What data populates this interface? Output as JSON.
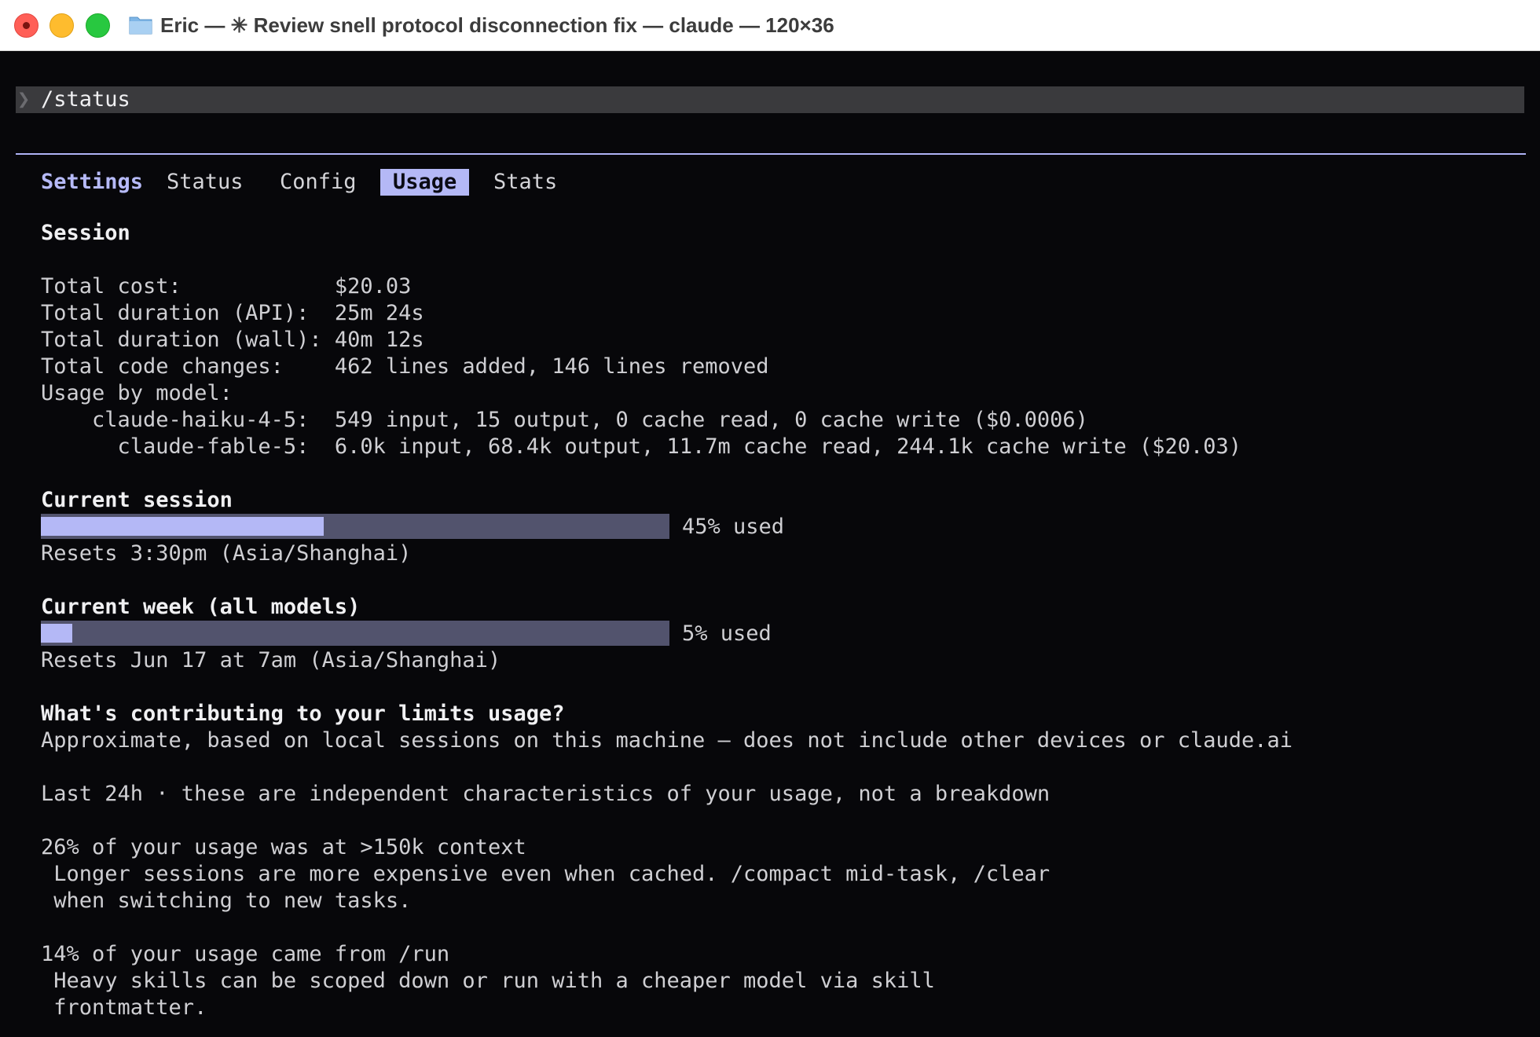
{
  "window": {
    "title": "Eric — ✳ Review snell protocol disconnection fix — claude — 120×36",
    "icon": "folder-icon"
  },
  "prompt": {
    "chevron": "❯",
    "command": "/status"
  },
  "tabs": {
    "title": "Settings",
    "items": [
      "Status",
      "Config",
      "Usage",
      "Stats"
    ],
    "active": "Usage"
  },
  "session": {
    "heading": "Session",
    "rows": [
      {
        "label": "Total cost:            ",
        "value": "$20.03"
      },
      {
        "label": "Total duration (API):  ",
        "value": "25m 24s"
      },
      {
        "label": "Total duration (wall): ",
        "value": "40m 12s"
      },
      {
        "label": "Total code changes:    ",
        "value": "462 lines added, 146 lines removed"
      }
    ],
    "usage_by_model_label": "Usage by model:",
    "models": [
      {
        "name": "    claude-haiku-4-5:  ",
        "value": "549 input, 15 output, 0 cache read, 0 cache write ($0.0006)"
      },
      {
        "name": "      claude-fable-5:  ",
        "value": "6.0k input, 68.4k output, 11.7m cache read, 244.1k cache write ($20.03)"
      }
    ]
  },
  "current_session": {
    "heading": "Current session",
    "percent": 45,
    "used_label": "45% used",
    "resets": "Resets 3:30pm (Asia/Shanghai)"
  },
  "current_week": {
    "heading": "Current week (all models)",
    "percent": 5,
    "used_label": "5% used",
    "resets": "Resets Jun 17 at 7am (Asia/Shanghai)"
  },
  "contributing": {
    "heading": "What's contributing to your limits usage?",
    "subtitle": "Approximate, based on local sessions on this machine — does not include other devices or claude.ai",
    "last24h": "Last 24h · these are independent characteristics of your usage, not a breakdown",
    "items": [
      {
        "headline": "26% of your usage was at >150k context",
        "detail1": " Longer sessions are more expensive even when cached. /compact mid-task, /clear",
        "detail2": " when switching to new tasks."
      },
      {
        "headline": "14% of your usage came from /run",
        "detail1": " Heavy skills can be scoped down or run with a cheaper model via skill",
        "detail2": " frontmatter."
      }
    ]
  },
  "colors": {
    "accent": "#b4b8f6",
    "bar_track": "#52536d",
    "terminal_bg": "#07070a"
  }
}
